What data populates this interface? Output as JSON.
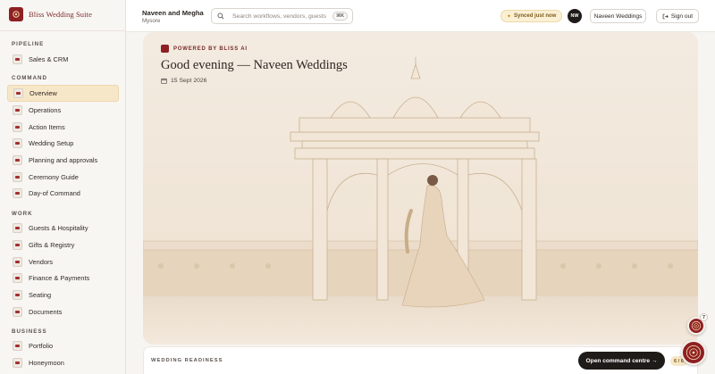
{
  "brand": {
    "name": "Bliss Wedding Suite"
  },
  "sidebar": {
    "sections": [
      {
        "label": "PIPELINE",
        "items": [
          {
            "label": "Sales & CRM",
            "icon": "chart-icon"
          }
        ]
      },
      {
        "label": "COMMAND",
        "items": [
          {
            "label": "Overview",
            "icon": "overview-icon",
            "active": true
          },
          {
            "label": "Operations",
            "icon": "operations-icon"
          },
          {
            "label": "Action Items",
            "icon": "action-items-icon"
          },
          {
            "label": "Wedding Setup",
            "icon": "setup-icon"
          },
          {
            "label": "Planning and approvals",
            "icon": "planning-icon"
          },
          {
            "label": "Ceremony Guide",
            "icon": "ceremony-icon"
          },
          {
            "label": "Day-of Command",
            "icon": "day-of-icon"
          }
        ]
      },
      {
        "label": "WORK",
        "items": [
          {
            "label": "Guests & Hospitality",
            "icon": "guests-icon"
          },
          {
            "label": "Gifts & Registry",
            "icon": "gift-icon"
          },
          {
            "label": "Vendors",
            "icon": "vendors-icon"
          },
          {
            "label": "Finance & Payments",
            "icon": "finance-icon"
          },
          {
            "label": "Seating",
            "icon": "seating-icon"
          },
          {
            "label": "Documents",
            "icon": "documents-icon"
          }
        ]
      },
      {
        "label": "BUSINESS",
        "items": [
          {
            "label": "Portfolio",
            "icon": "portfolio-icon"
          },
          {
            "label": "Honeymoon",
            "icon": "honeymoon-icon"
          }
        ]
      }
    ]
  },
  "header": {
    "couple": "Naveen and Megha",
    "location": "Mysore",
    "search_placeholder": "Search workflows, vendors, guests",
    "search_shortcut": "⌘K",
    "sync_status": "Synced just now",
    "avatar_initials": "NW",
    "account_button": "Naveen Weddings",
    "signout_button": "Sign out"
  },
  "hero": {
    "badge": "POWERED BY BLISS AI",
    "greeting": "Good evening — Naveen Weddings",
    "date": "15 Sept 2026"
  },
  "readiness": {
    "label": "WEDDING READINESS",
    "cta": "Open command centre →",
    "count": "6 / 6"
  },
  "floating": {
    "badge_count": "7"
  },
  "colors": {
    "brand": "#8e1f24",
    "accent": "#f6e7c8",
    "dark": "#1f1b19"
  }
}
